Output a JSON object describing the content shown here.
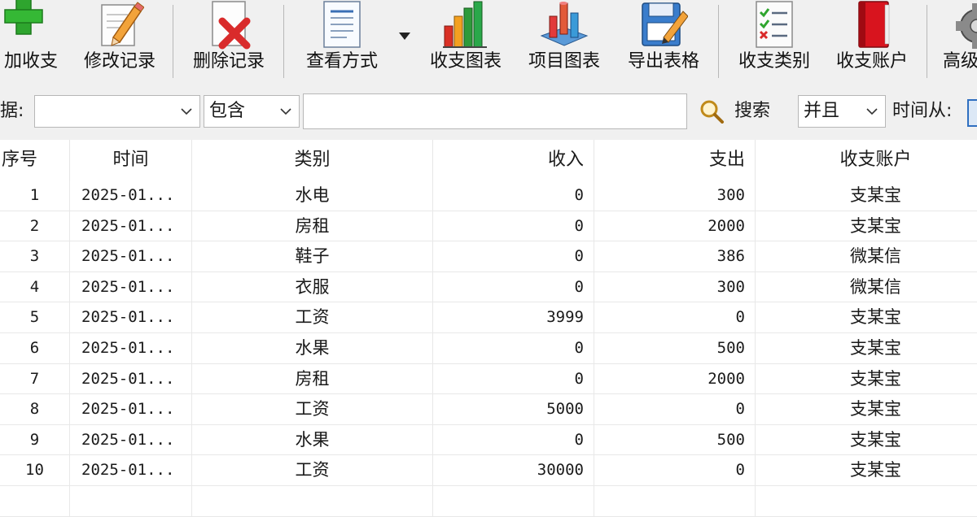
{
  "toolbar": {
    "buttons": [
      {
        "label": "加收支",
        "icon": "plus-icon"
      },
      {
        "label": "修改记录",
        "icon": "pencil-icon"
      },
      {
        "label": "删除记录",
        "icon": "delete-icon"
      },
      {
        "label": "查看方式",
        "icon": "document-icon"
      },
      {
        "label": "收支图表",
        "icon": "bar-chart-icon"
      },
      {
        "label": "项目图表",
        "icon": "3d-chart-icon"
      },
      {
        "label": "导出表格",
        "icon": "export-icon"
      },
      {
        "label": "收支类别",
        "icon": "checklist-icon"
      },
      {
        "label": "收支账户",
        "icon": "book-icon"
      },
      {
        "label": "高级",
        "icon": "gear-icon"
      }
    ]
  },
  "search": {
    "field_label": "据:",
    "field_value": "",
    "condition_value": "包含",
    "keyword_value": "",
    "search_label": "搜索",
    "logic_value": "并且",
    "time_label": "时间从:"
  },
  "grid": {
    "columns": [
      "序号",
      "时间",
      "类别",
      "收入",
      "支出",
      "收支账户"
    ],
    "rows": [
      [
        "1",
        "2025-01...",
        "水电",
        "0",
        "300",
        "支某宝"
      ],
      [
        "2",
        "2025-01...",
        "房租",
        "0",
        "2000",
        "支某宝"
      ],
      [
        "3",
        "2025-01...",
        "鞋子",
        "0",
        "386",
        "微某信"
      ],
      [
        "4",
        "2025-01...",
        "衣服",
        "0",
        "300",
        "微某信"
      ],
      [
        "5",
        "2025-01...",
        "工资",
        "3999",
        "0",
        "支某宝"
      ],
      [
        "6",
        "2025-01...",
        "水果",
        "0",
        "500",
        "支某宝"
      ],
      [
        "7",
        "2025-01...",
        "房租",
        "0",
        "2000",
        "支某宝"
      ],
      [
        "8",
        "2025-01...",
        "工资",
        "5000",
        "0",
        "支某宝"
      ],
      [
        "9",
        "2025-01...",
        "水果",
        "0",
        "500",
        "支某宝"
      ],
      [
        "10",
        "2025-01...",
        "工资",
        "30000",
        "0",
        "支某宝"
      ]
    ]
  }
}
